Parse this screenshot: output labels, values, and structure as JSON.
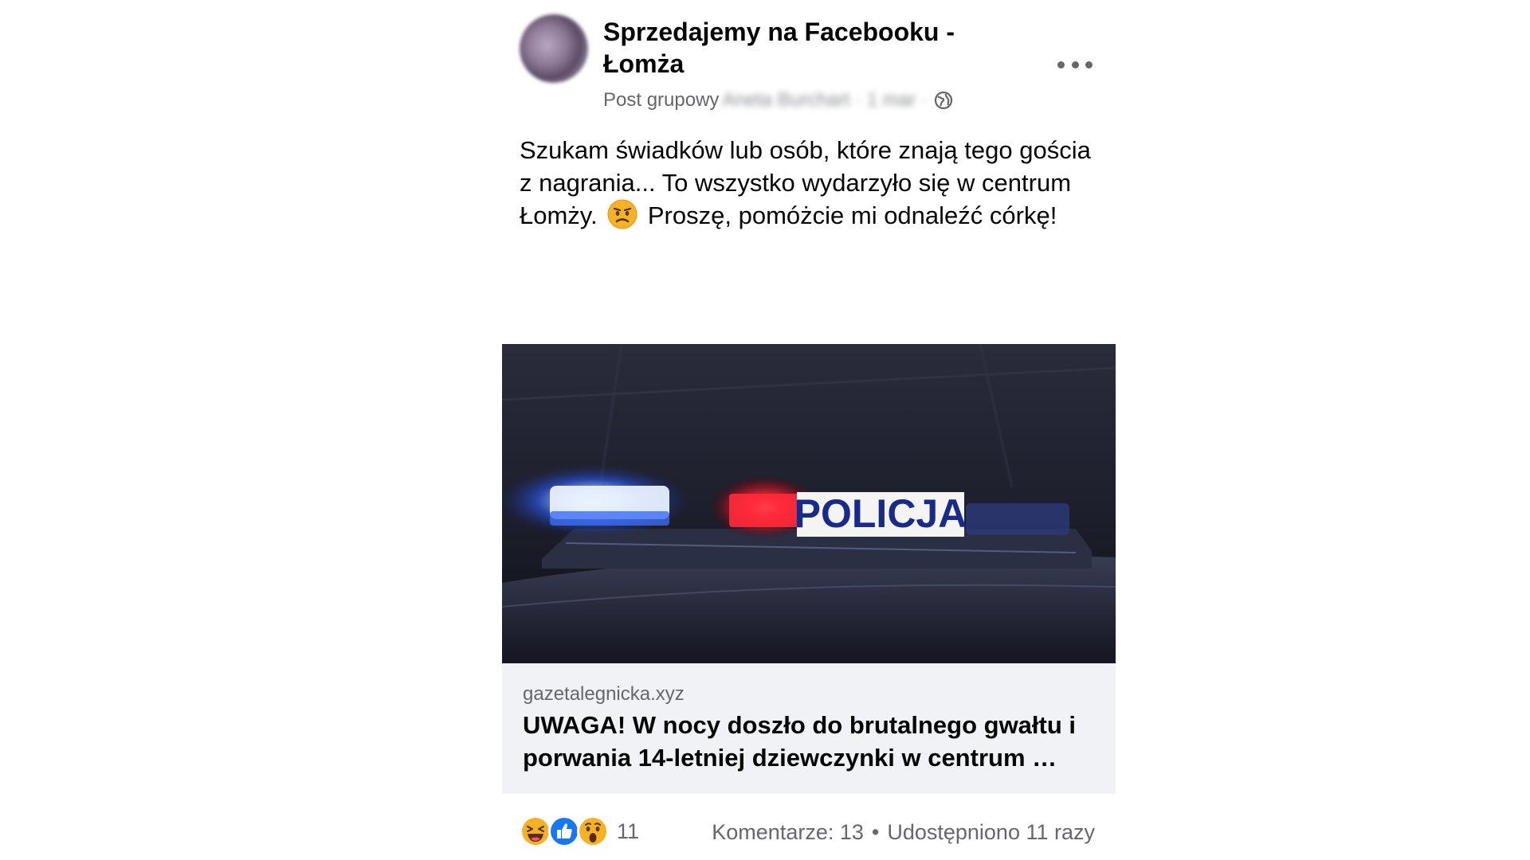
{
  "post": {
    "group_name": "Sprzedajemy na Facebooku - Łomża",
    "meta_prefix": "Post grupowy",
    "author_blurred": "Aneta Burchart · 1 mar ·",
    "more_icon": "more-horizontal-icon",
    "privacy_icon": "globe-icon",
    "text_part1": "Szukam świadków lub osób, które znają tego gościa z nagrania... To wszystko wydarzyło się w centrum Łomży.",
    "text_emoji": "frowning-face-emoji",
    "text_part2": "Proszę, pomóżcie mi odnaleźć córkę!"
  },
  "link_card": {
    "image_text": "POLICJA",
    "image_description_icon": "police-car-lightbar-image",
    "domain": "gazetalegnicka.xyz",
    "headline": "UWAGA! W nocy doszło do brutalnego gwałtu i porwania 14-letniej dziewczynki w centrum …"
  },
  "footer": {
    "reaction_icons": [
      "haha-reaction-icon",
      "like-reaction-icon",
      "wow-reaction-icon"
    ],
    "reaction_count": "11",
    "comments": "Komentarze: 13",
    "separator": "•",
    "shares": "Udostępniono 11 razy"
  },
  "colors": {
    "text_primary": "#050505",
    "text_secondary": "#65676b",
    "card_background": "#f0f2f5",
    "like_blue": "#1877f2",
    "emoji_yellow": "#f7b125"
  }
}
